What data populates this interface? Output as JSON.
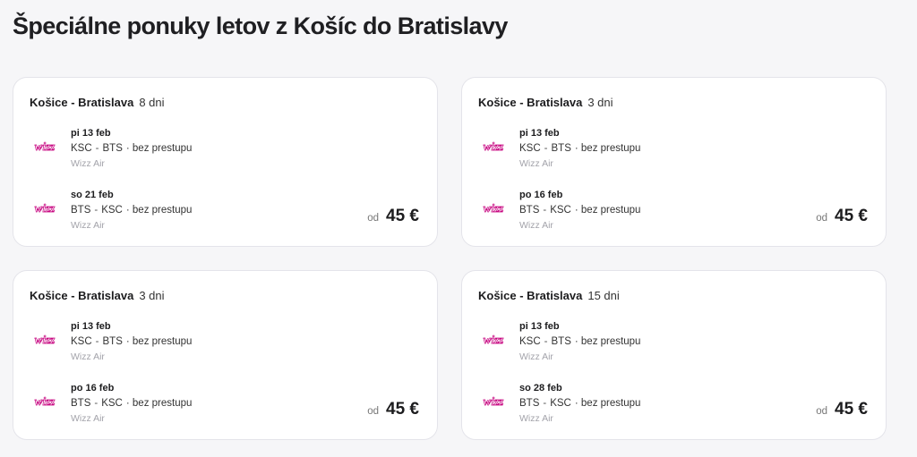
{
  "page": {
    "title": "Špeciálne ponuky letov z Košíc do Bratislavy"
  },
  "brand": {
    "card_bg": "#ffffff",
    "page_bg": "#f6f6f8",
    "logo_color": "#c6007e"
  },
  "offers": [
    {
      "route": "Košice - Bratislava",
      "duration": "8 dni",
      "outbound": {
        "date": "pi 13 feb",
        "from": "KSC",
        "to": "BTS",
        "stops": "· bez prestupu",
        "airline": "Wizz Air",
        "logo_icon": "wizzair-logo-icon"
      },
      "inbound": {
        "date": "so 21 feb",
        "from": "BTS",
        "to": "KSC",
        "stops": "· bez prestupu",
        "airline": "Wizz Air",
        "logo_icon": "wizzair-logo-icon"
      },
      "price_prefix": "od",
      "price": "45 €"
    },
    {
      "route": "Košice - Bratislava",
      "duration": "3 dni",
      "outbound": {
        "date": "pi 13 feb",
        "from": "KSC",
        "to": "BTS",
        "stops": "· bez prestupu",
        "airline": "Wizz Air",
        "logo_icon": "wizzair-logo-icon"
      },
      "inbound": {
        "date": "po 16 feb",
        "from": "BTS",
        "to": "KSC",
        "stops": "· bez prestupu",
        "airline": "Wizz Air",
        "logo_icon": "wizzair-logo-icon"
      },
      "price_prefix": "od",
      "price": "45 €"
    },
    {
      "route": "Košice - Bratislava",
      "duration": "3 dni",
      "outbound": {
        "date": "pi 13 feb",
        "from": "KSC",
        "to": "BTS",
        "stops": "· bez prestupu",
        "airline": "Wizz Air",
        "logo_icon": "wizzair-logo-icon"
      },
      "inbound": {
        "date": "po 16 feb",
        "from": "BTS",
        "to": "KSC",
        "stops": "· bez prestupu",
        "airline": "Wizz Air",
        "logo_icon": "wizzair-logo-icon"
      },
      "price_prefix": "od",
      "price": "45 €"
    },
    {
      "route": "Košice - Bratislava",
      "duration": "15 dni",
      "outbound": {
        "date": "pi 13 feb",
        "from": "KSC",
        "to": "BTS",
        "stops": "· bez prestupu",
        "airline": "Wizz Air",
        "logo_icon": "wizzair-logo-icon"
      },
      "inbound": {
        "date": "so 28 feb",
        "from": "BTS",
        "to": "KSC",
        "stops": "· bez prestupu",
        "airline": "Wizz Air",
        "logo_icon": "wizzair-logo-icon"
      },
      "price_prefix": "od",
      "price": "45 €"
    }
  ]
}
